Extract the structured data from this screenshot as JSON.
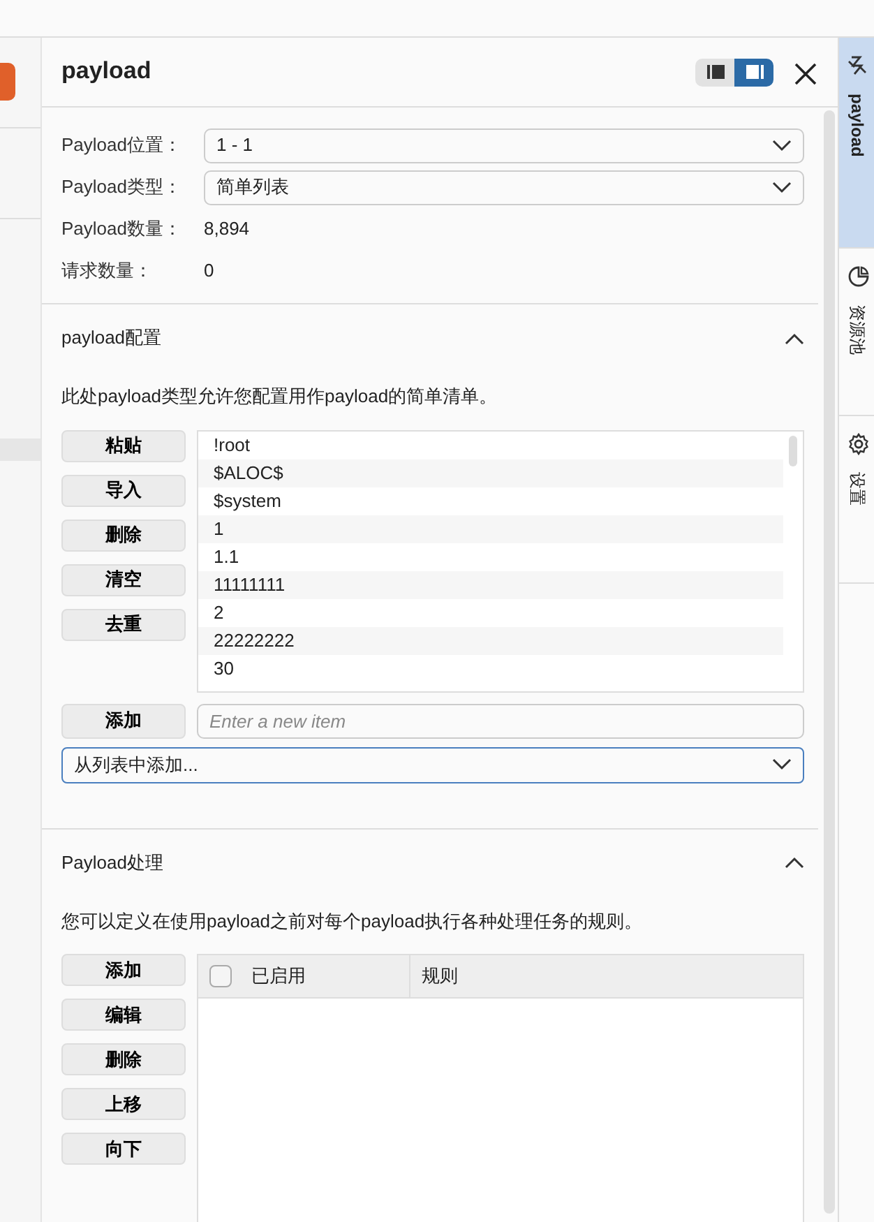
{
  "panel": {
    "title": "payload",
    "view_toggle": [
      {
        "kind": "left",
        "selected": false
      },
      {
        "kind": "right",
        "selected": true
      }
    ]
  },
  "fields": [
    {
      "label": "Payload位置：",
      "kind": "select",
      "value": "1 - 1"
    },
    {
      "label": "Payload类型：",
      "kind": "select",
      "value": "简单列表"
    },
    {
      "label": "Payload数量：",
      "kind": "text",
      "value": "8,894"
    },
    {
      "label": "请求数量：",
      "kind": "text",
      "value": "0"
    }
  ],
  "payload_config": {
    "title": "payload配置",
    "expanded": true,
    "description": "此处payload类型允许您配置用作payload的简单清单。",
    "buttons": [
      "粘贴",
      "导入",
      "删除",
      "清空",
      "去重"
    ],
    "items": [
      "!root",
      "$ALOC$",
      "$system",
      "1",
      "1.1",
      "11111111",
      "2",
      "22222222",
      "30"
    ],
    "add_button": "添加",
    "new_item": {
      "placeholder": "Enter a new item"
    },
    "add_from_list": {
      "value": "从列表中添加..."
    }
  },
  "payload_processing": {
    "title": "Payload处理",
    "expanded": true,
    "description": "您可以定义在使用payload之前对每个payload执行各种处理任务的规则。",
    "buttons": [
      "添加",
      "编辑",
      "删除",
      "上移",
      "向下"
    ],
    "table": {
      "select_all": {
        "checked": false
      },
      "columns": [
        "已启用",
        "规则"
      ]
    }
  },
  "side_tabs": [
    {
      "kind": "payload",
      "label": "payload",
      "selected": true
    },
    {
      "kind": "pool",
      "label": "资源池",
      "selected": false
    },
    {
      "kind": "settings",
      "label": "设置",
      "selected": false
    }
  ]
}
